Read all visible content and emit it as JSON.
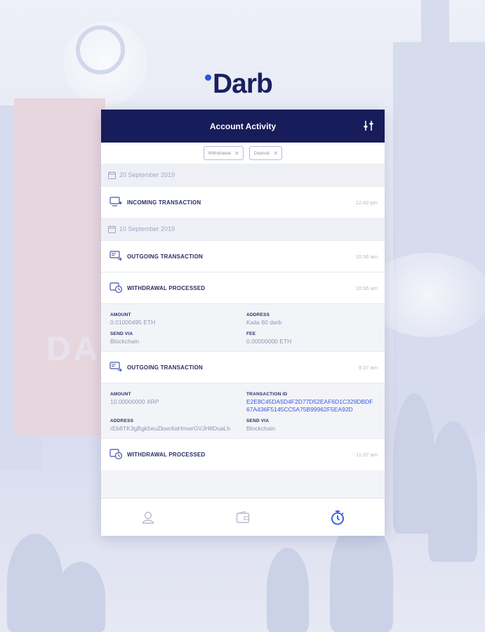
{
  "brand": {
    "name": "Darb",
    "accent": "#2d54e0",
    "navy": "#171c5a"
  },
  "header": {
    "title": "Account Activity",
    "filter_icon": "sliders-icon"
  },
  "filters": [
    {
      "label": "Withdrawal",
      "remove": "×"
    },
    {
      "label": "Deposit",
      "remove": "×"
    }
  ],
  "activity": {
    "date_1": "20 September 2019",
    "tx_1": {
      "name": "INCOMING TRANSACTION",
      "time": "12:42 pm"
    },
    "date_2": "10 September 2019",
    "tx_2": {
      "name": "OUTGOING TRANSACTION",
      "time": "10:36 am"
    },
    "tx_3": {
      "name": "WITHDRAWAL PROCESSED",
      "time": "10:36 am",
      "amount_label": "AMOUNT",
      "amount": "0.01000495 ETH",
      "address_label": "ADDRESS",
      "address": "Kaila 60 darb",
      "send_via_label": "SEND VIA",
      "send_via": "Blockchain",
      "fee_label": "FEE",
      "fee": "0.00000000 ETH"
    },
    "tx_4": {
      "name": "OUTGOING TRANSACTION",
      "time": "9:37 am",
      "amount_label": "AMOUNT",
      "amount": "10.00000000 XRP",
      "txid_label": "TRANSACTION ID",
      "txid": "E2E8C45DA5D4F2D77D52EAF6D1C329DBDF67A436F5145CC5A75B99962F5EA92D",
      "address_label": "ADDRESS",
      "address": "rEb8TK3gBgk5euZkwc6aHmwrGVJH8DuaLh",
      "send_via_label": "SEND VIA",
      "send_via": "Blockchain"
    },
    "tx_5": {
      "name": "WITHDRAWAL PROCESSED",
      "time": "11:37 am"
    }
  },
  "tabs": [
    {
      "icon": "profile-icon",
      "active": false
    },
    {
      "icon": "wallet-icon",
      "active": false
    },
    {
      "icon": "stopwatch-icon",
      "active": true
    }
  ]
}
